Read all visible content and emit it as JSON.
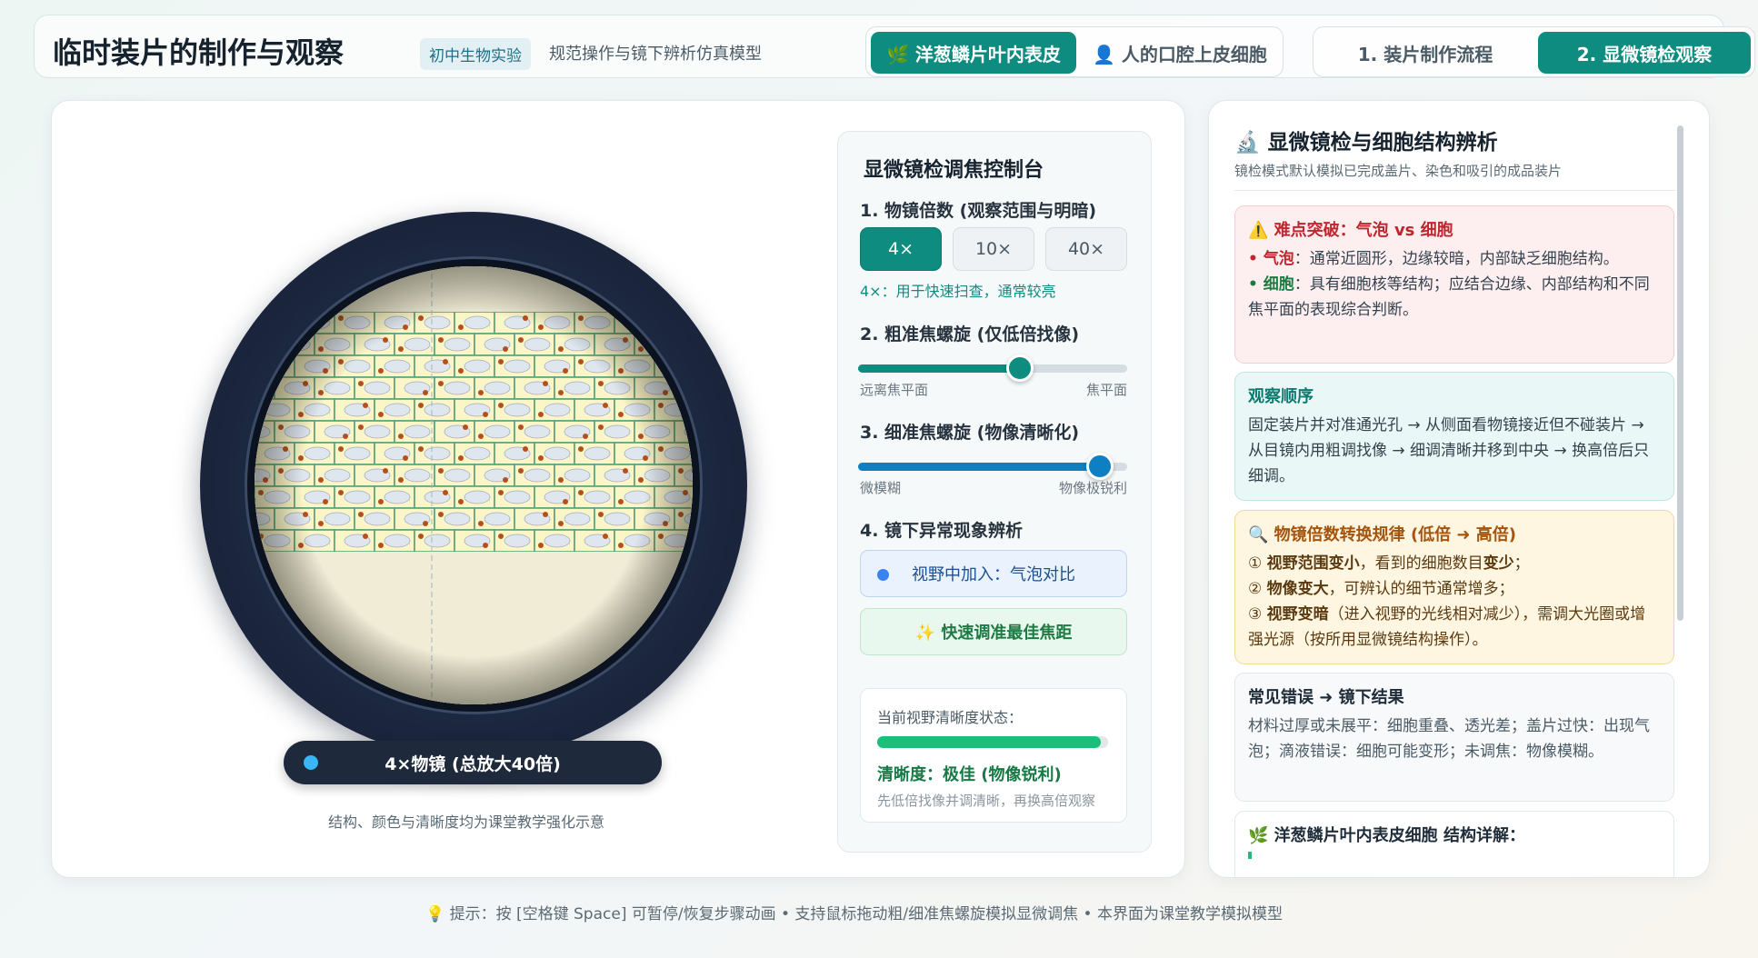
{
  "header": {
    "title": "临时装片的制作与观察",
    "badge": "初中生物实验",
    "subtitle": "规范操作与镜下辨析仿真模型",
    "specimen_tabs": [
      {
        "label": "🌿 洋葱鳞片叶内表皮",
        "active": true
      },
      {
        "label": "👤 人的口腔上皮细胞",
        "active": false
      }
    ],
    "mode_tabs": [
      {
        "label": "1. 装片制作流程",
        "active": false
      },
      {
        "label": "2. 显微镜检观察",
        "active": true
      }
    ]
  },
  "microscope": {
    "magnification_label": "4×物镜 (总放大40倍)",
    "caption": "结构、颜色与清晰度均为课堂教学强化示意"
  },
  "controls": {
    "title": "显微镜检调焦控制台",
    "objective": {
      "heading": "1. 物镜倍数 (观察范围与明暗)",
      "options": [
        "4×",
        "10×",
        "40×"
      ],
      "selected": "4×",
      "hint": "4×：用于快速扫查，通常较亮"
    },
    "coarse": {
      "heading": "2. 粗准焦螺旋 (仅低倍找像)",
      "value": 0.6,
      "min_label": "远离焦平面",
      "max_label": "焦平面"
    },
    "fine": {
      "heading": "3. 细准焦螺旋 (物像清晰化)",
      "value": 0.9,
      "min_label": "微模糊",
      "max_label": "物像极锐利"
    },
    "anomaly": {
      "heading": "4. 镜下异常现象辨析",
      "button": "视野中加入：气泡对比",
      "quick_button": "✨ 快速调准最佳焦距"
    },
    "status": {
      "label": "当前视野清晰度状态：",
      "clarity": 0.97,
      "value": "清晰度：极佳 (物像锐利)",
      "tip": "先低倍找像并调清晰，再换高倍观察"
    }
  },
  "panel": {
    "title": "🔬 显微镜检与细胞结构辨析",
    "subtitle": "镜检模式默认模拟已完成盖片、染色和吸引的成品装片",
    "cards": [
      {
        "title": "⚠️ 难点突破：气泡 vs 细胞",
        "lines": [
          {
            "b": "• 气泡",
            "t": "：通常近圆形，边缘较暗，内部缺乏细胞结构。"
          },
          {
            "b": "• 细胞",
            "t": "：具有细胞核等结构；应结合边缘、内部结构和不同焦平面的表现综合判断。"
          }
        ]
      },
      {
        "title": "观察顺序",
        "body": "固定装片并对准通光孔 → 从侧面看物镜接近但不碰装片 → 从目镜内用粗调找像 → 细调清晰并移到中央 → 换高倍后只细调。"
      },
      {
        "title": "🔍 物镜倍数转换规律 (低倍 ➜ 高倍)",
        "lines": [
          {
            "p": "① ",
            "b": "视野范围变小",
            "t": "，看到的细胞数目",
            "b2": "变少",
            "t2": "；"
          },
          {
            "p": "② ",
            "b": "物像变大",
            "t": "，可辨认的细节通常增多；"
          },
          {
            "p": "③ ",
            "b": "视野变暗",
            "t": "（进入视野的光线相对减少），需调大光圈或增强光源（按所用显微镜结构操作）。"
          }
        ]
      },
      {
        "title": "常见错误 ➜ 镜下结果",
        "body": "材料过厚或未展平：细胞重叠、透光差；盖片过快：出现气泡；滴液错误：细胞可能变形；未调焦：物像模糊。"
      },
      {
        "title": "🌿 洋葱鳞片叶内表皮细胞 结构详解："
      }
    ]
  },
  "footer": "💡 提示：按 [空格键 Space] 可暂停/恢复步骤动画 • 支持鼠标拖动粗/细准焦螺旋模拟显微调焦 • 本界面为课堂教学模拟模型",
  "colors": {
    "accent": "#0d8c7f",
    "slider": "#0f7fc4",
    "clarity": "#1cbf7a",
    "warn_bg": "#fdeff0",
    "info_bg": "#e9f8f6",
    "tip_bg": "#fff6e2"
  }
}
